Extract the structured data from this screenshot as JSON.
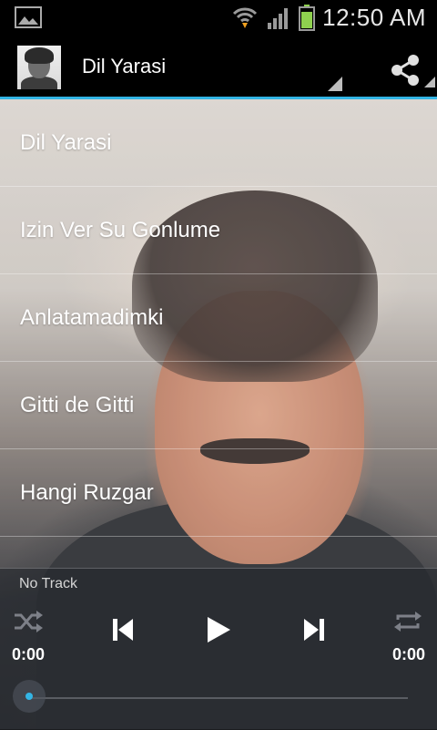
{
  "status_bar": {
    "time": "12:50 AM",
    "icons": [
      "gallery-icon",
      "wifi-icon",
      "signal-icon",
      "battery-icon"
    ]
  },
  "action_bar": {
    "title": "Dil Yarasi",
    "share_icon": "share-icon"
  },
  "tracks": [
    {
      "label": "Dil Yarasi"
    },
    {
      "label": "Izin Ver Su Gonlume"
    },
    {
      "label": "Anlatamadimki"
    },
    {
      "label": "Gitti de Gitti"
    },
    {
      "label": "Hangi Ruzgar"
    }
  ],
  "player": {
    "now_playing": "No Track",
    "elapsed": "0:00",
    "duration": "0:00",
    "progress": 0,
    "controls": [
      "shuffle-icon",
      "previous-icon",
      "play-icon",
      "next-icon",
      "repeat-icon"
    ]
  },
  "colors": {
    "accent": "#33b5e5",
    "bar_background": "#000000"
  }
}
